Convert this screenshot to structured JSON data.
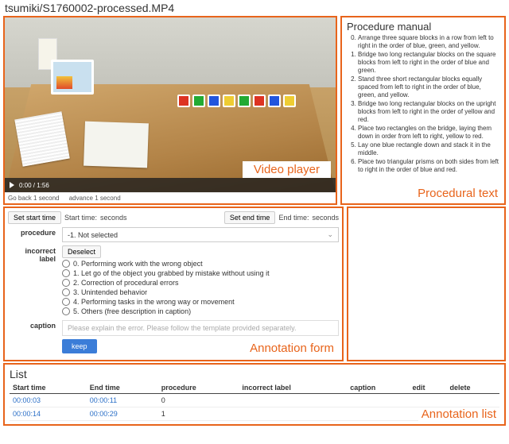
{
  "title": "tsumiki/S1760002-processed.MP4",
  "video": {
    "time_display": "0:00 / 1:56",
    "go_back": "Go back 1 second",
    "advance": "advance 1 second",
    "overlay_label": "Video player"
  },
  "procedure_panel": {
    "heading": "Procedure manual",
    "steps": [
      "Arrange three square blocks in a row from left to right in the order of blue, green, and yellow.",
      "Bridge two long rectangular blocks on the square blocks from left to right in the order of blue and green.",
      "Stand three short rectangular blocks equally spaced from left to right in the order of blue, green, and yellow.",
      "Bridge two long rectangular blocks on the upright blocks from left to right in the order of yellow and red.",
      "Place two rectangles on the bridge, laying them down in order from left to right, yellow to red.",
      "Lay one blue rectangle down and stack it in the middle.",
      "Place two triangular prisms on both sides from left to right in the order of blue and red."
    ],
    "overlay_label": "Procedural text"
  },
  "form": {
    "set_start_btn": "Set start time",
    "start_label": "Start time:",
    "seconds_label": "seconds",
    "set_end_btn": "Set end time",
    "end_label": "End time:",
    "procedure_label": "procedure",
    "procedure_value": "-1. Not selected",
    "incorrect_label": "incorrect label",
    "deselect_btn": "Deselect",
    "options": [
      "0. Performing work with the wrong object",
      "1. Let go of the object you grabbed by mistake without using it",
      "2. Correction of procedural errors",
      "3. Unintended behavior",
      "4. Performing tasks in the wrong way or movement",
      "5. Others (free description in caption)"
    ],
    "caption_label": "caption",
    "caption_placeholder": "Please explain the error. Please follow the template provided separately.",
    "keep_btn": "keep",
    "overlay_label": "Annotation form"
  },
  "list": {
    "heading": "List",
    "cols": {
      "start": "Start time",
      "end": "End time",
      "proc": "procedure",
      "inc": "incorrect label",
      "cap": "caption",
      "edit": "edit",
      "del": "delete"
    },
    "rows": [
      {
        "start": "00:00:03",
        "end": "00:00:11",
        "proc": "0",
        "inc": "",
        "cap": ""
      },
      {
        "start": "00:00:14",
        "end": "00:00:29",
        "proc": "1",
        "inc": "",
        "cap": ""
      }
    ],
    "overlay_label": "Annotation list"
  }
}
